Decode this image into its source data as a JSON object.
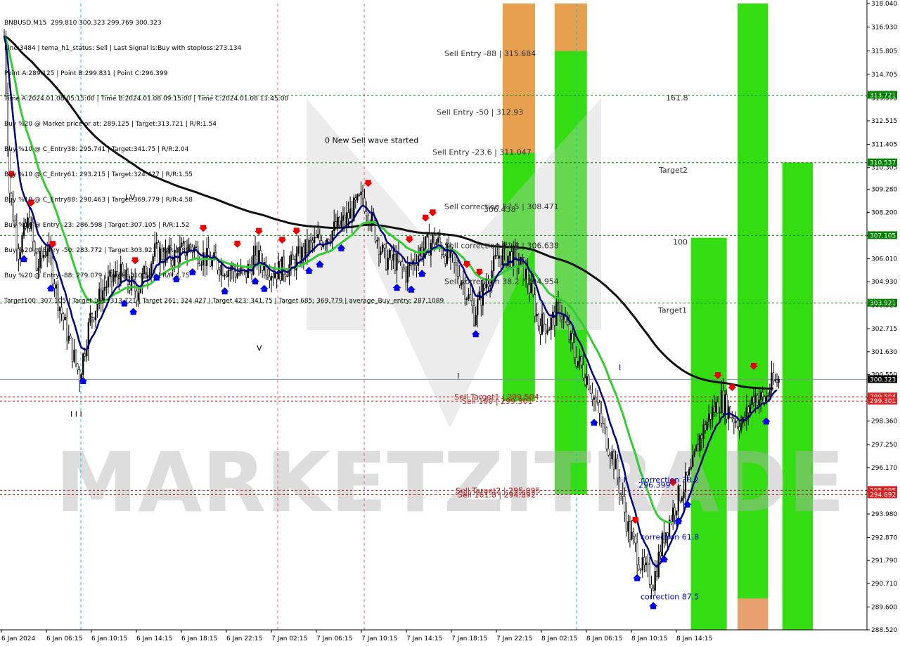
{
  "header": {
    "symbol_line": "BNBUSD,M15  299.810 300.323 299.769 300.323",
    "lines": [
      "Line:3484 | tema_h1_status: Sell | Last Signal is:Buy with stoploss:273.134",
      "Point A:289.125 | Point B:299.831 | Point C:296.399",
      "Time A:2024.01.08 05:15:00 | Time B:2024.01.08 09:15:00 | Time C:2024.01.08 11:45:00",
      "Buy %20 @ Market price or at: 289.125 | Target:313.721 | R/R:1.54",
      "Buy %10 @ C_Entry38: 295.741 | Target:341.75 | R/R:2.04",
      "Buy %10 @ C_Entry61: 293.215 | Target:324.427 | R/R:1.55",
      "Buy %10 @ C_Entry88: 290.463 | Target:369.779 | R/R:4.58",
      "Buy %10 @ Entry -23: 286.598 | Target:307.105 | R/R:1.52",
      "Buy %20 @ Entry -50: 283.772 | Target:303.921 | R/R:1.89",
      "Buy %20 @ Entry -88: 279.079 | Target:310.537 | R/R:4.75",
      "Target100: 307.105 | Target 161: 313.721 | Target 261: 324.427 | Target 423: 341.75 | Target 685: 369.779 | average_Buy_entry: 287.1089"
    ]
  },
  "watermark": {
    "text": "MARKETZITRADE"
  },
  "colors": {
    "green_zone": "#33dd11",
    "orange_zone": "#e6a050",
    "salmon_zone": "#e8a070",
    "ema_fast": "#000080",
    "ema_mid": "#33cc33",
    "ema_slow": "#111111",
    "level_green": "#008000",
    "level_red": "#b22222",
    "sell_arrow": "#ee0000",
    "buy_arrow": "#0000ee",
    "current_price_bg": "#000000"
  },
  "chart_data": {
    "type": "candlestick",
    "symbol": "BNBUSD",
    "timeframe": "M15",
    "ylim": [
      288.52,
      318.04
    ],
    "y_ticks": [
      "318.040",
      "316.930",
      "315.805",
      "314.705",
      "313.595",
      "312.515",
      "311.405",
      "310.305",
      "309.280",
      "308.200",
      "307.105",
      "306.010",
      "304.930",
      "303.820",
      "302.715",
      "301.630",
      "300.550",
      "299.450",
      "298.360",
      "297.250",
      "296.170",
      "295.060",
      "293.980",
      "292.870",
      "291.790",
      "290.710",
      "289.600",
      "288.520"
    ],
    "x_ticks": [
      "6 Jan 2024",
      "6 Jan 06:15",
      "6 Jan 10:15",
      "6 Jan 14:15",
      "6 Jan 18:15",
      "6 Jan 22:15",
      "7 Jan 02:15",
      "7 Jan 06:15",
      "7 Jan 10:15",
      "7 Jan 14:15",
      "7 Jan 18:15",
      "7 Jan 22:15",
      "8 Jan 02:15",
      "8 Jan 06:15",
      "8 Jan 10:15",
      "8 Jan 14:15"
    ],
    "levels": [
      {
        "price": 313.721,
        "label": "313.721",
        "color": "green"
      },
      {
        "price": 310.537,
        "label": "310.537",
        "color": "green"
      },
      {
        "price": 307.105,
        "label": "307.105",
        "color": "green"
      },
      {
        "price": 303.921,
        "label": "303.921",
        "color": "green"
      },
      {
        "price": 300.323,
        "label": "300.323",
        "color": "current"
      },
      {
        "price": 299.504,
        "label": "299.504",
        "color": "red"
      },
      {
        "price": 299.301,
        "label": "299.301",
        "color": "red"
      },
      {
        "price": 295.095,
        "label": "295.095",
        "color": "red"
      },
      {
        "price": 294.892,
        "label": "294.892",
        "color": "red"
      }
    ],
    "annotations": [
      {
        "text": "Sell Entry -88 | 315.684",
        "price": 315.684,
        "color": "#333333"
      },
      {
        "text": "Sell Entry -50 | 312.93",
        "price": 312.93,
        "color": "#333333"
      },
      {
        "text": "Sell Entry -23.6 | 311.047",
        "price": 311.047,
        "color": "#333333"
      },
      {
        "text": "Sell correction 87.5 | 308.471",
        "price": 308.471,
        "color": "#333333"
      },
      {
        "text": "306.438",
        "price": 308.35,
        "color": "#333333"
      },
      {
        "text": "Sell correction 61.8 | 306.638",
        "price": 306.638,
        "color": "#333333"
      },
      {
        "text": "Sell correction 38.2 | 304.954",
        "price": 304.954,
        "color": "#333333"
      },
      {
        "text": "Sell Target1 | 299.504",
        "price": 299.504,
        "color": "#b22222"
      },
      {
        "text": "Sell 100 | 299.301",
        "price": 299.301,
        "color": "#b22222"
      },
      {
        "text": "Sell Target2 | 295.095",
        "price": 295.095,
        "color": "#b22222"
      },
      {
        "text": "Sell 161.8 | 294.892",
        "price": 294.892,
        "color": "#b22222"
      },
      {
        "text": "161.8",
        "price": 313.6,
        "color": "#333333"
      },
      {
        "text": "Target2",
        "price": 310.2,
        "color": "#333333"
      },
      {
        "text": "100",
        "price": 306.8,
        "color": "#333333"
      },
      {
        "text": "Target1",
        "price": 303.6,
        "color": "#333333"
      },
      {
        "text": "correction 38.2",
        "price": 295.6,
        "color": "#0000cc"
      },
      {
        "text": "correction 61.8",
        "price": 292.9,
        "color": "#0000cc"
      },
      {
        "text": "correction 87.5",
        "price": 290.1,
        "color": "#0000cc"
      },
      {
        "text": "296.399",
        "price": 295.35,
        "color": "#0000cc"
      },
      {
        "text": "0 New Sell wave started",
        "price": 311.6,
        "color": "#000000"
      },
      {
        "text": "I V",
        "price": 308.9,
        "color": "#000000"
      },
      {
        "text": "V",
        "price": 301.8,
        "color": "#000000"
      },
      {
        "text": "I I I",
        "price": 298.7,
        "color": "#000000"
      },
      {
        "text": "I",
        "price": 300.9,
        "color": "#000080"
      },
      {
        "text": "I",
        "price": 300.5,
        "color": "#000000"
      },
      {
        "text": "I I",
        "price": 295.6,
        "color": "#000080"
      }
    ],
    "zones": [
      {
        "x_start": 278,
        "x_end": 296,
        "y_top": 318.04,
        "y_bottom": 299.3,
        "color": "green"
      },
      {
        "x_start": 278,
        "x_end": 296,
        "y_top": 318.04,
        "y_bottom": 311.0,
        "color": "orange"
      },
      {
        "x_start": 307,
        "x_end": 325,
        "y_top": 318.04,
        "y_bottom": 294.9,
        "color": "green"
      },
      {
        "x_start": 307,
        "x_end": 325,
        "y_top": 318.04,
        "y_bottom": 315.8,
        "color": "orange"
      },
      {
        "x_start": 383,
        "x_end": 403,
        "y_top": 307.0,
        "y_bottom": 288.52,
        "color": "green"
      },
      {
        "x_start": 409,
        "x_end": 426,
        "y_top": 318.04,
        "y_bottom": 288.52,
        "color": "green"
      },
      {
        "x_start": 409,
        "x_end": 426,
        "y_top": 290.0,
        "y_bottom": 288.52,
        "color": "salmon"
      },
      {
        "x_start": 434,
        "x_end": 451,
        "y_top": 310.55,
        "y_bottom": 288.52,
        "color": "green"
      }
    ],
    "current_price": 300.323
  }
}
